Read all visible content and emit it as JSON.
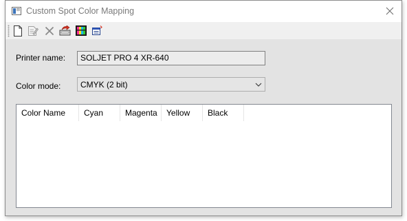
{
  "window": {
    "title": "Custom Spot Color Mapping",
    "close_symbol": "✕"
  },
  "toolbar": {
    "buttons": [
      {
        "icon": "new-document-icon"
      },
      {
        "icon": "edit-icon"
      },
      {
        "icon": "delete-icon"
      },
      {
        "icon": "import-icon"
      },
      {
        "icon": "color-palette-icon"
      },
      {
        "icon": "properties-icon"
      }
    ]
  },
  "form": {
    "printer_label": "Printer name:",
    "printer_value": "SOLJET PRO 4 XR-640",
    "color_mode_label": "Color mode:",
    "color_mode_value": "CMYK (2 bit)"
  },
  "table": {
    "columns": [
      "Color Name",
      "Cyan",
      "Magenta",
      "Yellow",
      "Black"
    ],
    "rows": []
  },
  "colors": {
    "title_text": "#7a7a7a",
    "content_bg": "#e3e3e3",
    "toolbar_bg": "#f0f0f0"
  }
}
